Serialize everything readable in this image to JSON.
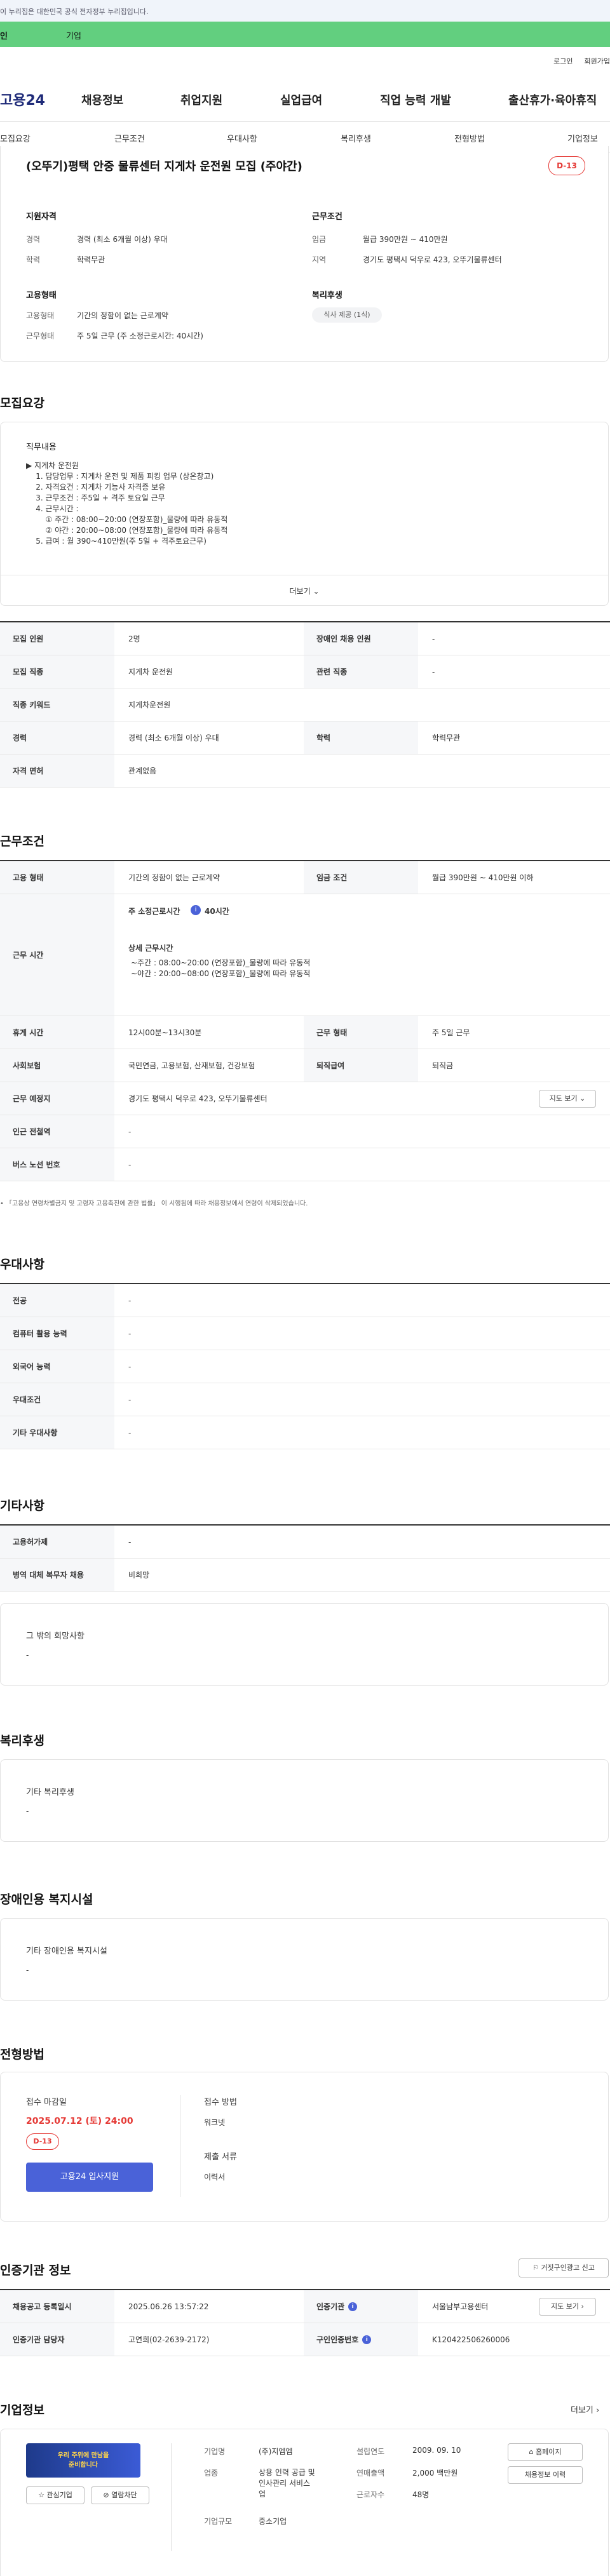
{
  "gov_banner": "이 누리집은 대한민국 공식 전자정부 누리집입니다.",
  "topbar": {
    "left": "인",
    "right": "기업"
  },
  "util": [
    "로그인",
    "회원가입"
  ],
  "gnb": {
    "logo": "고용24",
    "menus": [
      "채용정보",
      "취업지원",
      "실업급여",
      "직업 능력 개발",
      "출산휴가·육아휴직"
    ]
  },
  "tabs": [
    "모집요강",
    "근무조건",
    "우대사항",
    "복리후생",
    "전형방법",
    "기업정보"
  ],
  "summary": {
    "title": "(오뚜기)평택 안중 물류센터 지게차 운전원 모집 (주야간)",
    "dday": "D-13",
    "qual": {
      "heading": "지원자격",
      "career_label": "경력",
      "career": "경력 (최소 6개월 이상) 우대",
      "edu_label": "학력",
      "edu": "학력무관"
    },
    "cond": {
      "heading": "근무조건",
      "wage_label": "임금",
      "wage": "월급 390만원 ~ 410만원",
      "region_label": "지역",
      "region": "경기도 평택시 덕우로 423, 오뚜기물류센터"
    },
    "emp": {
      "heading": "고용형태",
      "type_label": "고용형태",
      "type": "기간의 정함이 없는 근로계약",
      "hours_label": "근무형태",
      "hours": "주 5일 근무 (주 소정근로시간: 40시간)"
    },
    "welfare": {
      "heading": "복리후생",
      "chip": "식사 제공 (1식)"
    }
  },
  "recruit": {
    "heading": "모집요강",
    "duty_title": "직무내용",
    "duty_text": "▶ 지게차 운전원\n    1. 담당업무 : 지게차 운전 및 제품 피킹 업무 (상온창고)\n    2. 자격요건 : 지게차 기능사 자격증 보유\n    3. 근무조건 : 주5일 + 격주 토요일 근무\n    4. 근무시간 :\n        ① 주간 : 08:00~20:00 (연장포함)_물량에 따라 유동적\n        ② 야간 : 20:00~08:00 (연장포함)_물량에 따라 유동적\n    5. 급여 : 월 390~410만원(주 5일 + 격주토요근무)",
    "more": "더보기",
    "rows": [
      {
        "k1": "모집 인원",
        "v1": "2명",
        "k2": "장애인 채용 인원",
        "v2": "-"
      },
      {
        "k1": "모집 직종",
        "v1": "지게차 운전원",
        "k2": "관련 직종",
        "v2": "-"
      },
      {
        "k1": "직종 키워드",
        "v1": "지게차운전원"
      },
      {
        "k1": "경력",
        "v1": "경력 (최소 6개월 이상) 우대",
        "k2": "학력",
        "v2": "학력무관"
      },
      {
        "k1": "자격 면허",
        "v1": "관계없음"
      }
    ]
  },
  "work": {
    "heading": "근무조건",
    "type_k": "고용 형태",
    "type_v": "기간의 정함이 없는 근로계약",
    "wage_k": "임금 조건",
    "wage_v": "월급 390만원 ~ 410만원 이하",
    "time_k": "근무 시간",
    "time_title": "주 소정근로시간",
    "time_hours": "40시간",
    "time_detail_title": "상세 근무시간",
    "time_detail": "~주간 : 08:00~20:00 (연장포함)_물량에 따라 유동적\n~야간 : 20:00~08:00 (연장포함)_물량에 따라 유동적",
    "break_k": "휴게 시간",
    "break_v": "12시00분~13시30분",
    "shape_k": "근무 형태",
    "shape_v": "주 5일 근무",
    "ins_k": "사회보험",
    "ins_v": "국민연금, 고용보험, 산재보험, 건강보험",
    "sev_k": "퇴직급여",
    "sev_v": "퇴직금",
    "place_k": "근무 예정지",
    "place_v": "경기도 평택시 덕우로 423, 오뚜기물류센터",
    "map_btn": "지도 보기",
    "sub_k": "인근 전철역",
    "sub_v": "-",
    "bus_k": "버스 노선 번호",
    "bus_v": "-",
    "notice": "「고용상 연령차별금지 및 고령자 고용촉진에 관한 법률」 이 시행됨에 따라 채용정보에서 연령이 삭제되었습니다."
  },
  "pref": {
    "heading": "우대사항",
    "rows": [
      {
        "k": "전공",
        "v": "-"
      },
      {
        "k": "컴퓨터 활용 능력",
        "v": "-"
      },
      {
        "k": "외국어 능력",
        "v": "-"
      },
      {
        "k": "우대조건",
        "v": "-"
      },
      {
        "k": "기타 우대사항",
        "v": "-"
      }
    ]
  },
  "etc": {
    "heading": "기타사항",
    "rows": [
      {
        "k": "고용허가제",
        "v": "-"
      },
      {
        "k": "병역 대체 복무자 채용",
        "v": "비희망"
      }
    ],
    "hope_title": "그 밖의 희망사항",
    "hope_v": "-"
  },
  "welfare2": {
    "heading": "복리후생",
    "title": "기타 복리후생",
    "v": "-"
  },
  "disabled": {
    "heading": "장애인용 복지시설",
    "title": "기타 장애인용 복지시설",
    "v": "-"
  },
  "process": {
    "heading": "전형방법",
    "deadline_title": "접수 마감일",
    "deadline": "2025.07.12 (토) 24:00",
    "dday": "D-13",
    "apply_btn": "고용24 입사지원",
    "method_title": "접수 방법",
    "method_v": "워크넷",
    "doc_title": "제출 서류",
    "doc_v": "이력서"
  },
  "cert": {
    "heading": "인증기관 정보",
    "report_btn": "거짓구인광고 신고",
    "reg_k": "채용공고 등록일시",
    "reg_v": "2025.06.26 13:57:22",
    "org_k": "인증기관",
    "org_v": "서울남부고용센터",
    "map_btn": "지도 보기",
    "mgr_k": "인증기관 담당자",
    "mgr_v": "고연희(02-2639-2172)",
    "no_k": "구인인증번호",
    "no_v": "K120422506260006"
  },
  "company": {
    "heading": "기업정보",
    "more": "더보기",
    "interest_btn": "관심기업",
    "block_btn": "열람차단",
    "logo_text": "우리 주위에 만남을\n준비합니다",
    "name_k": "기업명",
    "name_v": "(주)지엠엠",
    "ind_k": "업종",
    "ind_v": "상용 인력 공급 및\n인사관리 서비스\n업",
    "size_k": "기업규모",
    "size_v": "중소기업",
    "est_k": "설립연도",
    "est_v": "2009. 09. 10",
    "sales_k": "연매출액",
    "sales_v": "2,000 백만원",
    "emp_k": "근로자수",
    "emp_v": "48명",
    "home_btn": "홈페이지",
    "jobs_btn": "채용정보 이력"
  }
}
